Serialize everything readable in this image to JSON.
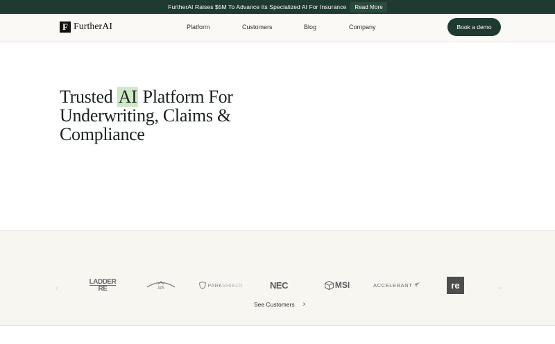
{
  "announcement": {
    "message": "FurtherAI Raises $5M To Advance Its Specialized AI For Insurance",
    "link_label": "Read More"
  },
  "header": {
    "logo_mark": "F",
    "logo_text": "FurtherAI",
    "nav": [
      "Platform",
      "Customers",
      "Blog",
      "Company"
    ],
    "cta_label": "Book a demo"
  },
  "hero": {
    "title_pre": "Trusted ",
    "title_highlight": "AI",
    "title_post": " Platform For Underwriting, Claims & Compliance"
  },
  "customers": {
    "logos": {
      "ladder_re": [
        "LADDER",
        "RE"
      ],
      "api": "API",
      "parkshield": [
        "PARK",
        "SHIELD"
      ],
      "nec": "NEC",
      "msi": "MSI",
      "accelerant": "ACCELERANT",
      "re": "re"
    },
    "see_label": "See Customers"
  },
  "colors": {
    "brand_green": "#1f3b31",
    "highlight": "#cfe9c6",
    "band_bg": "#f7f6f1"
  }
}
